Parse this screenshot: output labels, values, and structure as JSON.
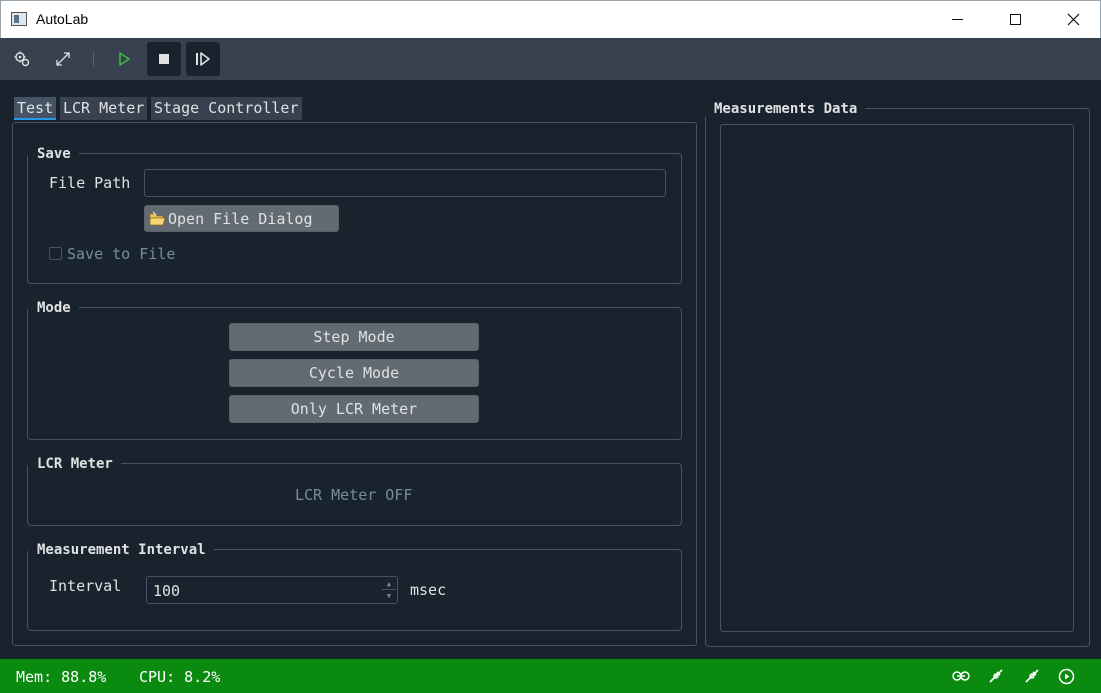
{
  "window": {
    "title": "AutoLab"
  },
  "toolbar": {
    "buttons": [
      {
        "icon": "settings-icon"
      },
      {
        "icon": "expand-icon"
      },
      {
        "icon": "play-icon"
      },
      {
        "icon": "stop-icon"
      },
      {
        "icon": "step-forward-icon"
      }
    ]
  },
  "tabs": [
    {
      "label": "Test",
      "active": true
    },
    {
      "label": "LCR Meter",
      "active": false
    },
    {
      "label": "Stage Controller",
      "active": false
    }
  ],
  "save": {
    "title": "Save",
    "file_path_label": "File Path",
    "file_path_value": "",
    "open_dialog_label": "Open File Dialog",
    "save_to_file_label": "Save to File",
    "save_to_file_checked": false
  },
  "mode": {
    "title": "Mode",
    "buttons": [
      "Step Mode",
      "Cycle Mode",
      "Only LCR Meter"
    ]
  },
  "lcr": {
    "title": "LCR Meter",
    "status": "LCR Meter OFF"
  },
  "interval": {
    "title": "Measurement Interval",
    "label": "Interval",
    "value": "100",
    "unit": "msec"
  },
  "measurements": {
    "title": "Measurements Data"
  },
  "status": {
    "mem": "Mem: 88.8%",
    "cpu": "CPU: 8.2%",
    "icons": [
      "link-icon",
      "probe-icon",
      "probe-icon",
      "play-circle-icon"
    ]
  },
  "colors": {
    "background": "#19232d",
    "toolbar": "#37414f",
    "statusbar": "#0b8a10",
    "accent": "#259ae9",
    "play": "#3db83d"
  }
}
